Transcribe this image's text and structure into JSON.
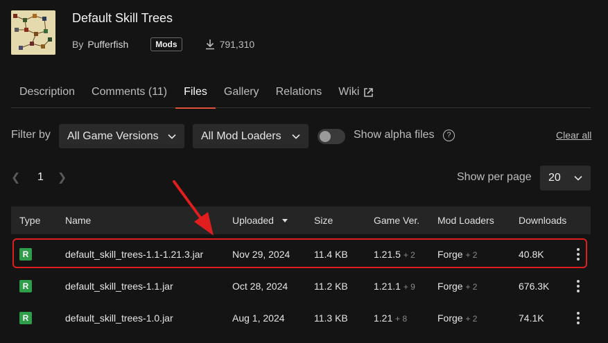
{
  "project": {
    "title": "Default Skill Trees",
    "by_label": "By",
    "author": "Pufferfish",
    "category_badge": "Mods",
    "downloads": "791,310"
  },
  "tabs": [
    {
      "label": "Description"
    },
    {
      "label": "Comments (11)"
    },
    {
      "label": "Files"
    },
    {
      "label": "Gallery"
    },
    {
      "label": "Relations"
    },
    {
      "label": "Wiki"
    }
  ],
  "filters": {
    "label": "Filter by",
    "game_versions": "All Game Versions",
    "mod_loaders": "All Mod Loaders",
    "alpha_label": "Show alpha files",
    "clear_label": "Clear all"
  },
  "pagination": {
    "page": "1",
    "per_page_label": "Show per page",
    "per_page_value": "20"
  },
  "table": {
    "headers": {
      "type": "Type",
      "name": "Name",
      "uploaded": "Uploaded",
      "size": "Size",
      "game_ver": "Game Ver.",
      "mod_loaders": "Mod Loaders",
      "downloads": "Downloads"
    },
    "rows": [
      {
        "type": "R",
        "name": "default_skill_trees-1.1-1.21.3.jar",
        "uploaded": "Nov 29, 2024",
        "size": "11.4 KB",
        "game_ver": "1.21.5",
        "game_ver_extra": "+ 2",
        "loader": "Forge",
        "loader_extra": "+ 2",
        "downloads": "40.8K"
      },
      {
        "type": "R",
        "name": "default_skill_trees-1.1.jar",
        "uploaded": "Oct 28, 2024",
        "size": "11.2 KB",
        "game_ver": "1.21.1",
        "game_ver_extra": "+ 9",
        "loader": "Forge",
        "loader_extra": "+ 2",
        "downloads": "676.3K"
      },
      {
        "type": "R",
        "name": "default_skill_trees-1.0.jar",
        "uploaded": "Aug 1, 2024",
        "size": "11.3 KB",
        "game_ver": "1.21",
        "game_ver_extra": "+ 8",
        "loader": "Forge",
        "loader_extra": "+ 2",
        "downloads": "74.1K"
      }
    ]
  },
  "colors": {
    "accent": "#e0523a",
    "release_badge": "#2f9d4a",
    "annotation": "#e01e1e"
  }
}
